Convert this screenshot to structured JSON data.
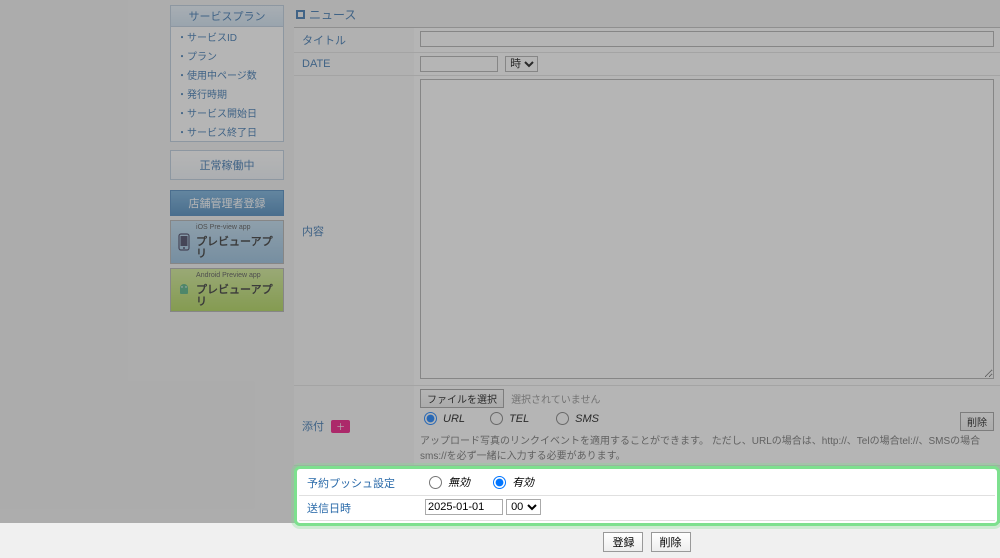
{
  "sidebar": {
    "panel_title": "サービスプラン",
    "items": [
      "サービスID",
      "プラン",
      "使用中ページ数",
      "発行時期",
      "サービス開始日",
      "サービス終了日"
    ],
    "status_label": "正常稼働中",
    "admin_label": "店舗管理者登録",
    "ios_sub": "iOS Pre-view app",
    "ios_main": "プレビューアプリ",
    "android_sub": "Android Preview app",
    "android_main": "プレビューアプリ"
  },
  "section_title": "ニュース",
  "form": {
    "title_label": "タイトル",
    "title_value": "",
    "date_label": "DATE",
    "date_value": "",
    "date_hour_options": [
      "時"
    ],
    "date_hour_selected": "時",
    "content_label": "内容",
    "content_value": "",
    "attach_label": "添付",
    "attach_badge": "＋",
    "file_button": "ファイルを選択",
    "file_status": "選択されていません",
    "link_options": [
      "URL",
      "TEL",
      "SMS"
    ],
    "link_selected": "URL",
    "delete_button": "削除",
    "hint": "アップロード写真のリンクイベントを適用することができます。 ただし、URLの場合は、http://、Telの場合tel://、SMSの場合sms://を必ず一緒に入力する必要があります。"
  },
  "push": {
    "label": "予約プッシュ設定",
    "options": [
      "無効",
      "有効"
    ],
    "selected": "有効",
    "send_label": "送信日時",
    "send_date": "2025-01-01",
    "send_hour_options": [
      "00"
    ],
    "send_hour_selected": "00"
  },
  "footer": {
    "submit": "登録",
    "delete": "削除"
  }
}
